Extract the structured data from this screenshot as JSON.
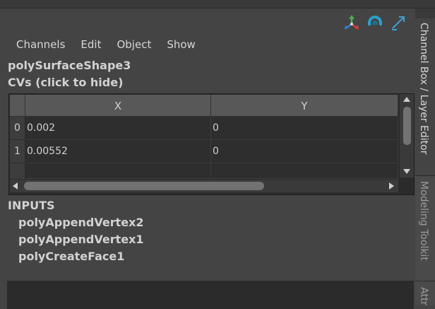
{
  "header_icons": [
    {
      "name": "transform-attributes-icon"
    },
    {
      "name": "rotate-attributes-icon"
    },
    {
      "name": "edit-attributes-icon"
    }
  ],
  "menu": [
    "Channels",
    "Edit",
    "Object",
    "Show"
  ],
  "node_name": "polySurfaceShape3",
  "section_title": "CVs (click to hide)",
  "table": {
    "columns": [
      "X",
      "Y"
    ],
    "rows": [
      {
        "index": "0",
        "x": "0.002",
        "y": "0"
      },
      {
        "index": "1",
        "x": "0.00552",
        "y": "0"
      }
    ]
  },
  "inputs_title": "INPUTS",
  "inputs": [
    "polyAppendVertex2",
    "polyAppendVertex1",
    "polyCreateFace1"
  ],
  "side_tabs": [
    "Channel Box / Layer Editor",
    "Modeling Toolkit",
    "Attr"
  ]
}
